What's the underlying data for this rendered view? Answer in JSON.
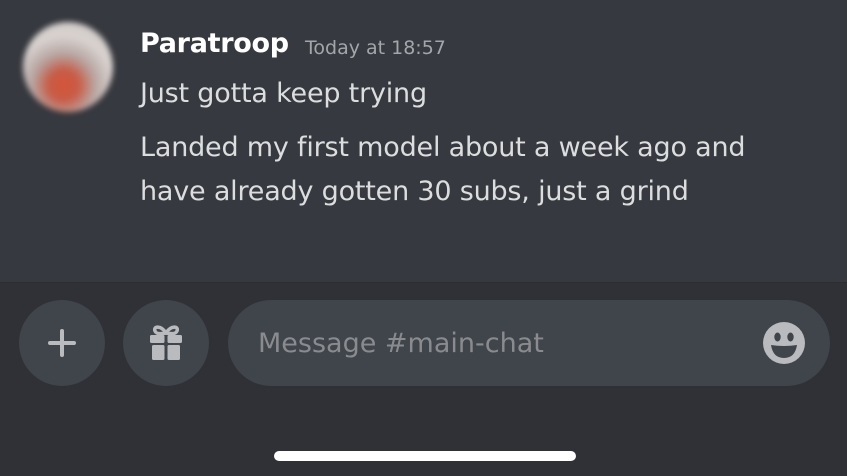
{
  "message": {
    "author": "Paratroop",
    "timestamp": "Today at 18:57",
    "lines": [
      "Just gotta keep trying",
      "Landed my first model about a week ago and",
      "have already gotten 30 subs, just a grind"
    ]
  },
  "composer": {
    "placeholder": "Message #main-chat",
    "value": ""
  },
  "icons": {
    "add": "plus-icon",
    "gift": "gift-icon",
    "emoji": "emoji-icon"
  },
  "colors": {
    "chat_bg": "#36393f",
    "bar_bg": "#2f3136",
    "control_bg": "#40444b",
    "author": "#ffffff",
    "text": "#dcddde",
    "muted": "#a3a6aa"
  }
}
